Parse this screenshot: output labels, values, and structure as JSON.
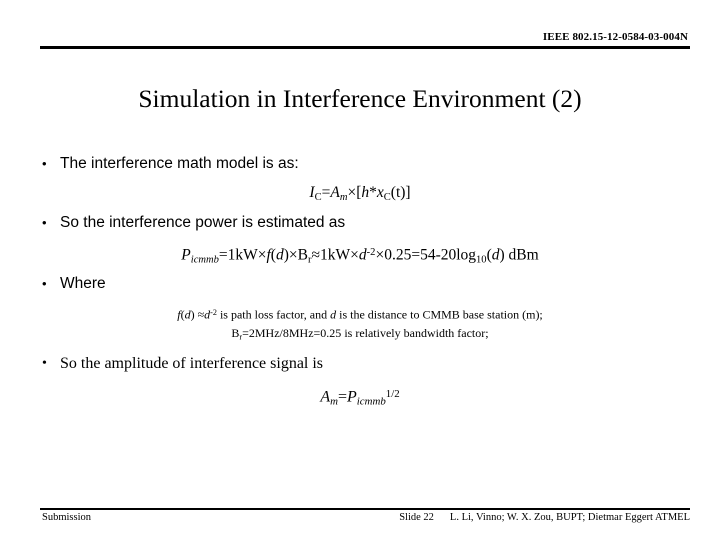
{
  "header": {
    "doc_id": "IEEE 802.15-12-0584-03-004N"
  },
  "title": "Simulation in Interference Environment (2)",
  "bullets": {
    "b1": "The interference math model is as:",
    "b2": "So the interference power is estimated as",
    "b3": "Where",
    "b4": "So the amplitude of interference signal is",
    "marker": "•"
  },
  "equations": {
    "eq1": {
      "full_text": "IC=Am×[h*xC(t)]",
      "lhs_var": "I",
      "lhs_sub": "C",
      "eq_sign": "=",
      "amp_var": "A",
      "amp_sub": "m",
      "times": "×",
      "bracket_open": "[",
      "h_var": "h",
      "conv": "*",
      "x_var": "x",
      "x_sub": "C",
      "t_arg": "(t)",
      "bracket_close": "]"
    },
    "eq2": {
      "full_text": "Picmmb=1kW×f(d)×Br≈1kW×d-2×0.25=54-20log10(d) dBm",
      "p_var": "P",
      "p_sub": "icmmb",
      "eq_sign": "=",
      "term1": "1kW",
      "times": "×",
      "f_var": "f",
      "d_paren_open": "(",
      "d_var": "d",
      "d_paren_close": ")",
      "br_var": "B",
      "br_sub": "r",
      "approx": "≈",
      "term2": "1kW",
      "d_var2": "d",
      "d_exp": "-2",
      "factor": "0.25",
      "result_eq": "=",
      "result": "54-20log",
      "log_base": "10",
      "result_arg_open": "(",
      "result_arg": "d",
      "result_arg_close": ")",
      "unit": "dBm"
    },
    "eq3": {
      "full_text": "Am=Picmmb1/2",
      "a_var": "A",
      "a_sub": "m",
      "eq_sign": "=",
      "p_var": "P",
      "p_sub": "icmmb",
      "exponent": "1/2"
    }
  },
  "where_lines": {
    "line1": {
      "full_text": "f(d) ≈d-2 is path loss factor, and d is the distance to CMMB base station (m);",
      "f_var": "f",
      "paren_open": "(",
      "d_var": "d",
      "paren_close": ")",
      "approx": "≈",
      "d_var2": "d",
      "d_exp": "-2",
      "text_mid": " is path loss factor, and ",
      "d_var3": "d",
      "text_end": " is the distance to CMMB base station (m);"
    },
    "line2": {
      "full_text": "Br=2MHz/8MHz=0.25 is relatively bandwidth factor;",
      "b_var": "B",
      "b_sub": "r",
      "body": "=2MHz/8MHz=0.25",
      "tail": " is relatively bandwidth factor;"
    }
  },
  "footer": {
    "left": "Submission",
    "slide": "Slide 22",
    "authors": "L. Li, Vinno; W. X. Zou, BUPT; Dietmar Eggert ATMEL"
  },
  "colors": {
    "text": "#000000",
    "background": "#ffffff",
    "rule": "#000000"
  }
}
